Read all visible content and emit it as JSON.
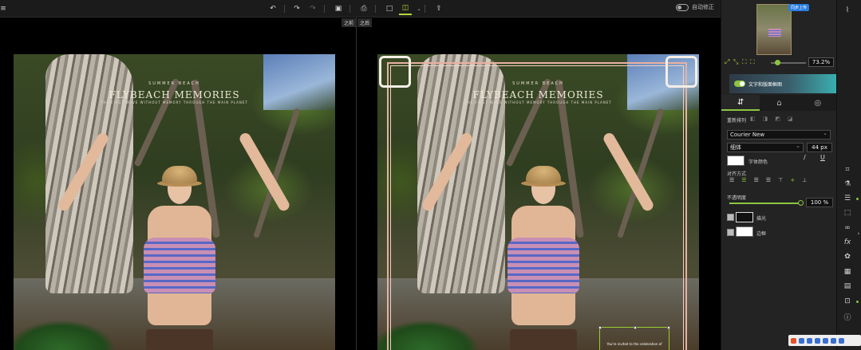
{
  "toolbar": {
    "auto_fix_label": "自动修正",
    "before_label": "之前",
    "after_label": "之后"
  },
  "poster": {
    "small_title": "SUMMER BEACH",
    "big_title": "FLYBEACH MEMORIES",
    "subtitle": "THE FIRST WAVE WITHOUT MEMORY THROUGH THE MAIN PLANET",
    "textbox_text": "You're invited to the celebration of"
  },
  "panel": {
    "upload_label": "同步上传",
    "zoom_value": "73.2%",
    "banner_text": "文字和版面框图",
    "arrange_label": "重新排列",
    "font_family": "Courier New",
    "font_style": "细体",
    "font_size": "44 px",
    "font_color_label": "字体颜色",
    "italic_label": "/",
    "underline_label": "U",
    "align_label": "对齐方式",
    "opacity_label": "不透明度",
    "opacity_value": "100 %",
    "shadow_label": "描光",
    "stroke_label": "边框"
  },
  "colors": {
    "accent": "#8cc63e",
    "frame": "#e9b0a0",
    "panel_bg": "#232323"
  },
  "icons": {
    "toolbar": [
      "undo-icon",
      "redo-icon",
      "redo-disabled-icon",
      "save-icon",
      "print-icon",
      "single-view-icon",
      "compare-view-icon",
      "share-icon"
    ],
    "tabs": [
      "adjust-tab-icon",
      "shape-tab-icon",
      "layer-tab-icon"
    ],
    "strip": [
      "histogram-icon",
      "crop-icon",
      "flask-icon",
      "sliders-icon",
      "select-icon",
      "glasses-icon",
      "fx-icon",
      "effects-icon",
      "texture-icon",
      "frame-icon",
      "text-icon",
      "info-icon"
    ]
  }
}
